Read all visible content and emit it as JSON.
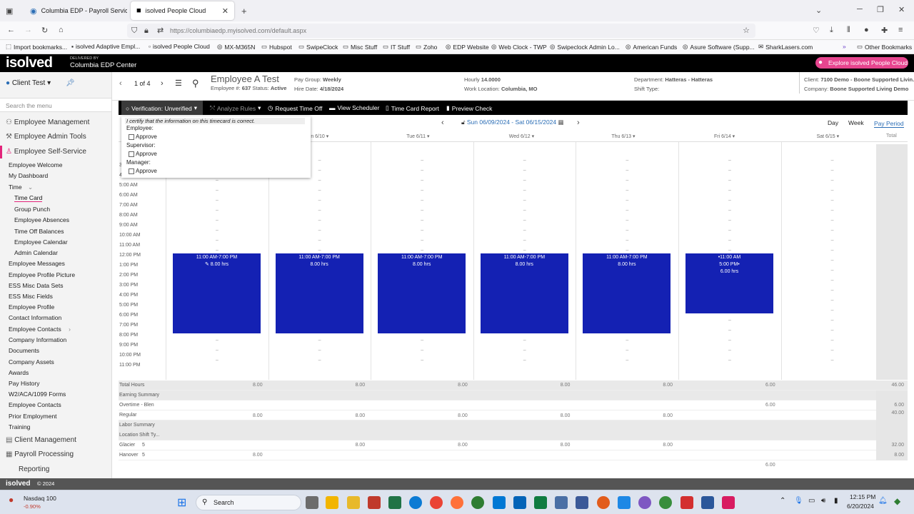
{
  "browser": {
    "tabs": [
      {
        "title": "Columbia EDP - Payroll Services"
      },
      {
        "title": "isolved People Cloud"
      }
    ],
    "url": "https://columbiaedp.myisolved.com/default.aspx",
    "bookmarks": [
      "Import bookmarks...",
      "isolved Adaptive Empl...",
      "isolved People Cloud",
      "MX-M365N",
      "Hubspot",
      "SwipeClock",
      "Misc Stuff",
      "IT Stuff",
      "Zoho",
      "EDP Website",
      "Web Clock - TWP",
      "Swipeclock Admin Lo...",
      "American Funds",
      "Asure Software (Supp...",
      "SharkLasers.com"
    ],
    "other_bookmarks": "Other Bookmarks"
  },
  "app": {
    "logo": "isolved",
    "delivered_by": "DELIVERED BY",
    "center_name": "Columbia EDP Center",
    "explore_label": "Explore isolved People Cloud",
    "footer": "isolved",
    "footer_year": "© 2024"
  },
  "sidebar": {
    "client": "Client Test",
    "search_placeholder": "Search the menu",
    "sections": {
      "employee_management": "Employee Management",
      "employee_admin_tools": "Employee Admin Tools",
      "employee_self_service": "Employee Self-Service",
      "client_management": "Client Management",
      "payroll_processing": "Payroll Processing",
      "reporting": "Reporting"
    },
    "items": [
      "Employee Welcome",
      "My Dashboard",
      "Time",
      "Time Card",
      "Group Punch",
      "Employee Absences",
      "Time Off Balances",
      "Employee Calendar",
      "Admin Calendar",
      "Employee Messages",
      "Employee Profile Picture",
      "ESS Misc Data Sets",
      "ESS Misc Fields",
      "Employee Profile",
      "Contact Information",
      "Employee Contacts",
      "Company Information",
      "Documents",
      "Company Assets",
      "Awards",
      "Pay History",
      "W2/ACA/1099 Forms",
      "Employee Contacts",
      "Prior Employment",
      "Training"
    ]
  },
  "employee": {
    "pager": "1 of 4",
    "name": "Employee A Test",
    "number_label": "Employee #:",
    "number": "637",
    "status_label": "Status:",
    "status": "Active",
    "pay_group_label": "Pay Group:",
    "pay_group": "Weekly",
    "hire_label": "Hire Date:",
    "hire_date": "4/18/2024",
    "rate_label": "Hourly",
    "rate": "14.0000",
    "work_loc_label": "Work Location:",
    "work_loc": "Columbia, MO",
    "dept_label": "Department:",
    "dept": "Hatteras - Hatteras",
    "shift_label": "Shift Type:",
    "client_label": "Client:",
    "client": "7100 Demo - Boone Supported Livin...",
    "company_label": "Company:",
    "company": "Boone Supported Living Demo"
  },
  "toolbar": {
    "verification": "Verification: Unverified",
    "analyze": "Analyze Rules",
    "request_time_off": "Request Time Off",
    "view_scheduler": "View Scheduler",
    "time_card_report": "Time Card Report",
    "preview_check": "Preview Check"
  },
  "popup": {
    "certify": "I certify that the information on this timecard is correct.",
    "employee": "Employee:",
    "supervisor": "Supervisor:",
    "manager": "Manager:",
    "approve": "Approve"
  },
  "timecard": {
    "date_range": "Sun 06/09/2024 - Sat 06/15/2024",
    "views": [
      "Day",
      "Week",
      "Pay Period"
    ],
    "days": [
      "Sun 6/9",
      "Mon 6/10",
      "Tue 6/11",
      "Wed 6/12",
      "Thu 6/13",
      "Fri 6/14",
      "Sat 6/15"
    ],
    "total_header": "Total",
    "hours": [
      "3:00 AM",
      "4:00 AM",
      "5:00 AM",
      "6:00 AM",
      "7:00 AM",
      "8:00 AM",
      "9:00 AM",
      "10:00 AM",
      "11:00 AM",
      "12:00 PM",
      "1:00 PM",
      "2:00 PM",
      "3:00 PM",
      "4:00 PM",
      "5:00 PM",
      "6:00 PM",
      "7:00 PM",
      "8:00 PM",
      "9:00 PM",
      "10:00 PM",
      "11:00 PM"
    ],
    "shifts": [
      {
        "time": "11:00 AM-7:00 PM",
        "hrs": "8.00 hrs"
      },
      {
        "time": "11:00 AM-7:00 PM",
        "hrs": "8.00 hrs"
      },
      {
        "time": "11:00 AM-7:00 PM",
        "hrs": "8.00 hrs"
      },
      {
        "time": "11:00 AM-7:00 PM",
        "hrs": "8.00 hrs"
      },
      {
        "time": "11:00 AM-7:00 PM",
        "hrs": "8.00 hrs"
      },
      {
        "time": "•11:00 AM",
        "time2": "5:00 PM•",
        "hrs": "6.00 hrs"
      }
    ],
    "rows": {
      "total_hours": "Total Hours",
      "earning_summary": "Earning Summary",
      "overtime": "Overtime - Blen",
      "regular": "Regular",
      "labor_summary": "Labor Summary",
      "location": "Location",
      "shift_type": "Shift Ty...",
      "glacier": "Glacier",
      "glacier_shift": "5",
      "hanover": "Hanover",
      "hanover_shift": "5"
    },
    "totals": [
      "8.00",
      "8.00",
      "8.00",
      "8.00",
      "8.00",
      "6.00",
      "46.00"
    ],
    "overtime_vals": {
      "fri": "6.00",
      "total": "6.00"
    },
    "regular_vals": [
      "8.00",
      "8.00",
      "8.00",
      "8.00",
      "8.00",
      "40.00"
    ],
    "glacier_vals": [
      "8.00",
      "8.00",
      "8.00",
      "8.00",
      "32.00"
    ],
    "hanover_vals": [
      "8.00",
      "8.00"
    ],
    "bottom_extra": "6.00"
  },
  "taskbar": {
    "ticker_name": "Nasdaq 100",
    "ticker_change": "-0.90%",
    "search": "Search",
    "time": "12:15 PM",
    "date": "6/20/2024"
  }
}
